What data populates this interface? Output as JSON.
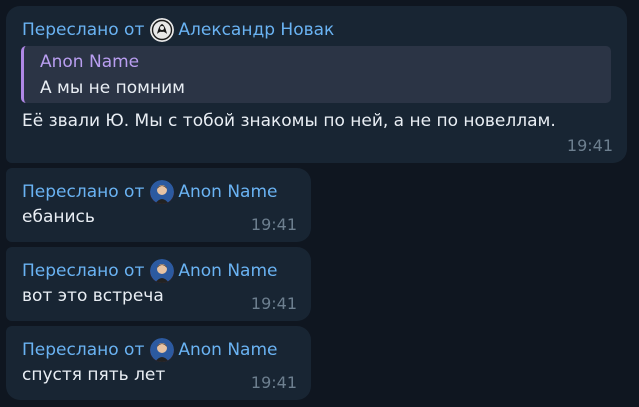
{
  "messages": [
    {
      "forwarded_label": "Переслано от",
      "forwarded_from": "Александр Новак",
      "reply": {
        "author": "Anon Name",
        "text": "А мы не помним"
      },
      "text": "Её звали Ю. Мы с тобой знакомы по ней, а не по новеллам.",
      "time": "19:41"
    },
    {
      "forwarded_label": "Переслано от",
      "forwarded_from": "Anon Name",
      "text": "ебанись",
      "time": "19:41"
    },
    {
      "forwarded_label": "Переслано от",
      "forwarded_from": "Anon Name",
      "text": "вот это встреча",
      "time": "19:41"
    },
    {
      "forwarded_label": "Переслано от",
      "forwarded_from": "Anon Name",
      "text": "спустя пять лет",
      "time": "19:41"
    }
  ],
  "colors": {
    "background": "#0e1621",
    "bubble": "#182533",
    "link": "#6ab3f3",
    "reply_accent": "#b088e6",
    "time": "#6d7f8f"
  }
}
